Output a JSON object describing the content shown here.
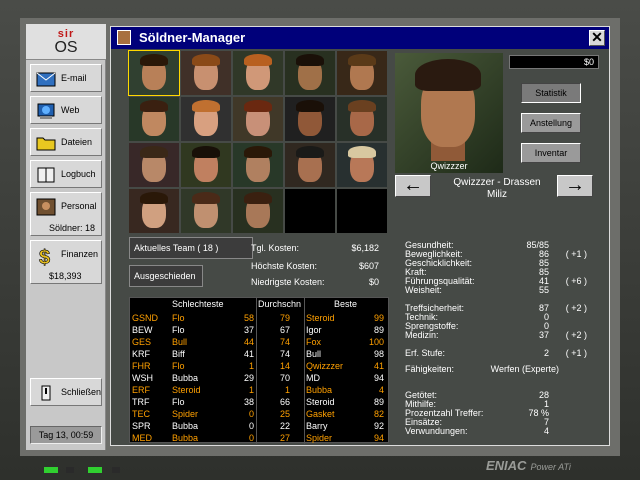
{
  "sidebar": {
    "logo_top": "sir",
    "logo_bottom": "OS",
    "email": "E-mail",
    "web": "Web",
    "files": "Dateien",
    "logbook": "Logbuch",
    "personnel": "Personal",
    "personnel_sub": "Söldner: 18",
    "finances": "Finanzen",
    "finances_sub": "$18,393",
    "close": "Schließen",
    "day": "Tag 13, 00:59"
  },
  "window": {
    "title": "Söldner-Manager",
    "close_glyph": "✕"
  },
  "team": {
    "current_label": "Aktuelles Team ( 18 )",
    "departed_label": "Ausgeschieden",
    "daily_cost_label": "Tgl. Kosten:",
    "daily_cost": "$6,182",
    "max_cost_label": "Höchste Kosten:",
    "max_cost": "$607",
    "min_cost_label": "Niedrigste Kosten:",
    "min_cost": "$0"
  },
  "stats_table": {
    "headers": {
      "worst": "Schlechteste",
      "avg": "Durchschn",
      "best": "Beste"
    },
    "rows": [
      {
        "stat": "GSND",
        "worst": "Flo",
        "wv": "58",
        "avg": "79",
        "best": "Steroid",
        "bv": "99",
        "hl": true
      },
      {
        "stat": "BEW",
        "worst": "Flo",
        "wv": "37",
        "avg": "67",
        "best": "Igor",
        "bv": "89",
        "hl": false
      },
      {
        "stat": "GES",
        "worst": "Bull",
        "wv": "44",
        "avg": "74",
        "best": "Fox",
        "bv": "100",
        "hl": true
      },
      {
        "stat": "KRF",
        "worst": "Biff",
        "wv": "41",
        "avg": "74",
        "best": "Bull",
        "bv": "98",
        "hl": false
      },
      {
        "stat": "FHR",
        "worst": "Flo",
        "wv": "1",
        "avg": "14",
        "best": "Qwizzzer",
        "bv": "41",
        "hl": true
      },
      {
        "stat": "WSH",
        "worst": "Bubba",
        "wv": "29",
        "avg": "70",
        "best": "MD",
        "bv": "94",
        "hl": false
      },
      {
        "stat": "ERF",
        "worst": "Steroid",
        "wv": "1",
        "avg": "1",
        "best": "Bubba",
        "bv": "4",
        "hl": true
      },
      {
        "stat": "TRF",
        "worst": "Flo",
        "wv": "38",
        "avg": "66",
        "best": "Steroid",
        "bv": "89",
        "hl": false
      },
      {
        "stat": "TEC",
        "worst": "Spider",
        "wv": "0",
        "avg": "25",
        "best": "Gasket",
        "bv": "82",
        "hl": true
      },
      {
        "stat": "SPR",
        "worst": "Bubba",
        "wv": "0",
        "avg": "22",
        "best": "Barry",
        "bv": "92",
        "hl": false
      },
      {
        "stat": "MED",
        "worst": "Bubba",
        "wv": "0",
        "avg": "27",
        "best": "Spider",
        "bv": "94",
        "hl": true
      }
    ]
  },
  "merc": {
    "money": "$0",
    "portrait_name": "Qwizzzer",
    "name_line1": "Qwizzzer - Drassen",
    "name_line2": "Miliz",
    "btn_stats": "Statistik",
    "btn_employ": "Anstellung",
    "btn_inventory": "Inventar",
    "attrs": [
      {
        "label": "Gesundheit:",
        "value": "85/85",
        "bonus": ""
      },
      {
        "label": "Beweglichkeit:",
        "value": "86",
        "bonus": "( +1 )"
      },
      {
        "label": "Geschicklichkeit:",
        "value": "85",
        "bonus": ""
      },
      {
        "label": "Kraft:",
        "value": "85",
        "bonus": ""
      },
      {
        "label": "Führungsqualität:",
        "value": "41",
        "bonus": "( +6 )"
      },
      {
        "label": "Weisheit:",
        "value": "55",
        "bonus": ""
      },
      {
        "label": "Treffsicherheit:",
        "value": "87",
        "bonus": "( +2 )"
      },
      {
        "label": "Technik:",
        "value": "0",
        "bonus": ""
      },
      {
        "label": "Sprengstoffe:",
        "value": "0",
        "bonus": ""
      },
      {
        "label": "Medizin:",
        "value": "37",
        "bonus": "( +2 )"
      },
      {
        "label": "Erf. Stufe:",
        "value": "2",
        "bonus": "( +1 )"
      },
      {
        "label": "Fähigkeiten:",
        "value": "Werfen (Experte)",
        "bonus": ""
      },
      {
        "label": "Getötet:",
        "value": "28",
        "bonus": ""
      },
      {
        "label": "Mithilfe:",
        "value": "1",
        "bonus": ""
      },
      {
        "label": "Prozentzahl Treffer:",
        "value": "78 %",
        "bonus": ""
      },
      {
        "label": "Einsätze:",
        "value": "7",
        "bonus": ""
      },
      {
        "label": "Verwundungen:",
        "value": "4",
        "bonus": ""
      }
    ]
  },
  "branding": {
    "name": "ENIAC",
    "model": "Power ATi"
  },
  "colors": {
    "highlight": "#ffa000",
    "titlebar": "#00007a",
    "selected": "#ffd800"
  }
}
